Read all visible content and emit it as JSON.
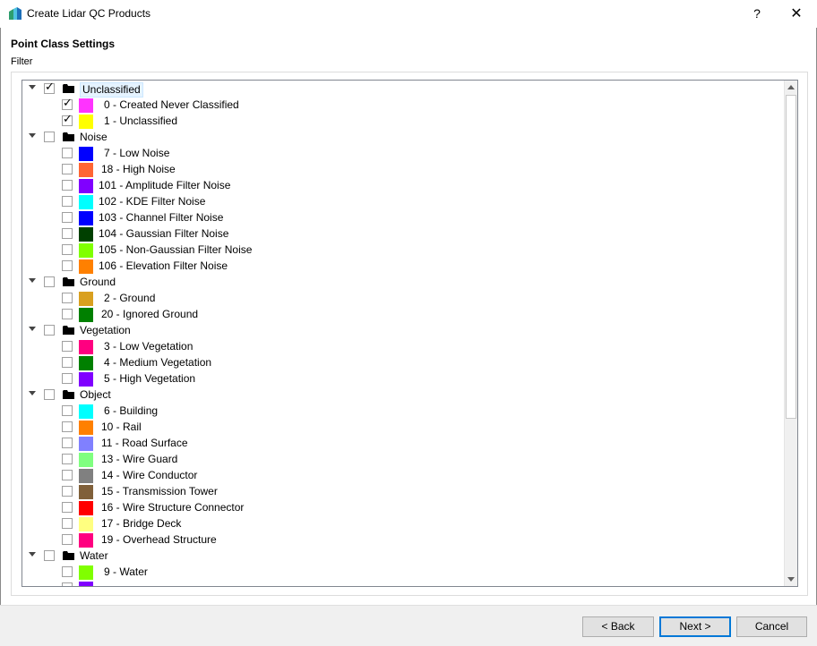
{
  "window": {
    "title": "Create Lidar QC Products",
    "help_label": "?",
    "close_label": "✕"
  },
  "section": {
    "title": "Point Class Settings",
    "filter_label": "Filter"
  },
  "tree": {
    "groups": [
      {
        "name": "Unclassified",
        "checked": true,
        "selected": true,
        "items": [
          {
            "label": "0 - Created Never Classified",
            "color": "#ff33ff",
            "checked": true
          },
          {
            "label": "1 - Unclassified",
            "color": "#ffff00",
            "checked": true
          }
        ]
      },
      {
        "name": "Noise",
        "checked": false,
        "items": [
          {
            "label": "7 - Low Noise",
            "color": "#0000ff",
            "checked": false
          },
          {
            "label": "18 - High Noise",
            "color": "#ff6633",
            "checked": false
          },
          {
            "label": "101 - Amplitude Filter Noise",
            "color": "#8000ff",
            "checked": false
          },
          {
            "label": "102 - KDE Filter Noise",
            "color": "#00ffff",
            "checked": false
          },
          {
            "label": "103 - Channel Filter Noise",
            "color": "#0000ff",
            "checked": false
          },
          {
            "label": "104 - Gaussian Filter Noise",
            "color": "#004000",
            "checked": false
          },
          {
            "label": "105 - Non-Gaussian Filter Noise",
            "color": "#80ff00",
            "checked": false
          },
          {
            "label": "106 - Elevation Filter Noise",
            "color": "#ff8000",
            "checked": false
          }
        ]
      },
      {
        "name": "Ground",
        "checked": false,
        "items": [
          {
            "label": "2 - Ground",
            "color": "#d9a020",
            "checked": false
          },
          {
            "label": "20 - Ignored Ground",
            "color": "#008000",
            "checked": false
          }
        ]
      },
      {
        "name": "Vegetation",
        "checked": false,
        "items": [
          {
            "label": "3 - Low Vegetation",
            "color": "#ff0080",
            "checked": false
          },
          {
            "label": "4 - Medium Vegetation",
            "color": "#008000",
            "checked": false
          },
          {
            "label": "5 - High Vegetation",
            "color": "#8000ff",
            "checked": false
          }
        ]
      },
      {
        "name": "Object",
        "checked": false,
        "items": [
          {
            "label": "6 - Building",
            "color": "#00ffff",
            "checked": false
          },
          {
            "label": "10 - Rail",
            "color": "#ff8000",
            "checked": false
          },
          {
            "label": "11 - Road Surface",
            "color": "#8080ff",
            "checked": false
          },
          {
            "label": "13 - Wire Guard",
            "color": "#80ff80",
            "checked": false
          },
          {
            "label": "14 - Wire Conductor",
            "color": "#808080",
            "checked": false
          },
          {
            "label": "15 - Transmission Tower",
            "color": "#80603a",
            "checked": false
          },
          {
            "label": "16 - Wire Structure Connector",
            "color": "#ff0000",
            "checked": false
          },
          {
            "label": "17 - Bridge Deck",
            "color": "#ffff80",
            "checked": false
          },
          {
            "label": "19 - Overhead Structure",
            "color": "#ff0080",
            "checked": false
          }
        ]
      },
      {
        "name": "Water",
        "checked": false,
        "items": [
          {
            "label": "9 - Water",
            "color": "#80ff00",
            "checked": false
          },
          {
            "label": "",
            "color": "#8000ff",
            "checked": false
          }
        ]
      }
    ]
  },
  "buttons": {
    "back": "< Back",
    "next": "Next >",
    "cancel": "Cancel"
  }
}
